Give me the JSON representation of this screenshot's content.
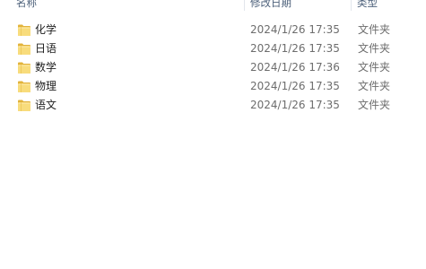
{
  "columns": {
    "name": "名称",
    "date": "修改日期",
    "type": "类型"
  },
  "files": [
    {
      "name": "化学",
      "date": "2024/1/26 17:35",
      "type": "文件夹",
      "icon": "folder-icon"
    },
    {
      "name": "日语",
      "date": "2024/1/26 17:35",
      "type": "文件夹",
      "icon": "folder-icon"
    },
    {
      "name": "数学",
      "date": "2024/1/26 17:36",
      "type": "文件夹",
      "icon": "folder-icon"
    },
    {
      "name": "物理",
      "date": "2024/1/26 17:35",
      "type": "文件夹",
      "icon": "folder-icon"
    },
    {
      "name": "语文",
      "date": "2024/1/26 17:35",
      "type": "文件夹",
      "icon": "folder-icon"
    }
  ],
  "colors": {
    "folder_light": "#f8dc7c",
    "folder_dark": "#e2b33a",
    "header_text": "#4c607a",
    "item_text": "#1e1e1e",
    "meta_text": "#6d6d6d"
  }
}
